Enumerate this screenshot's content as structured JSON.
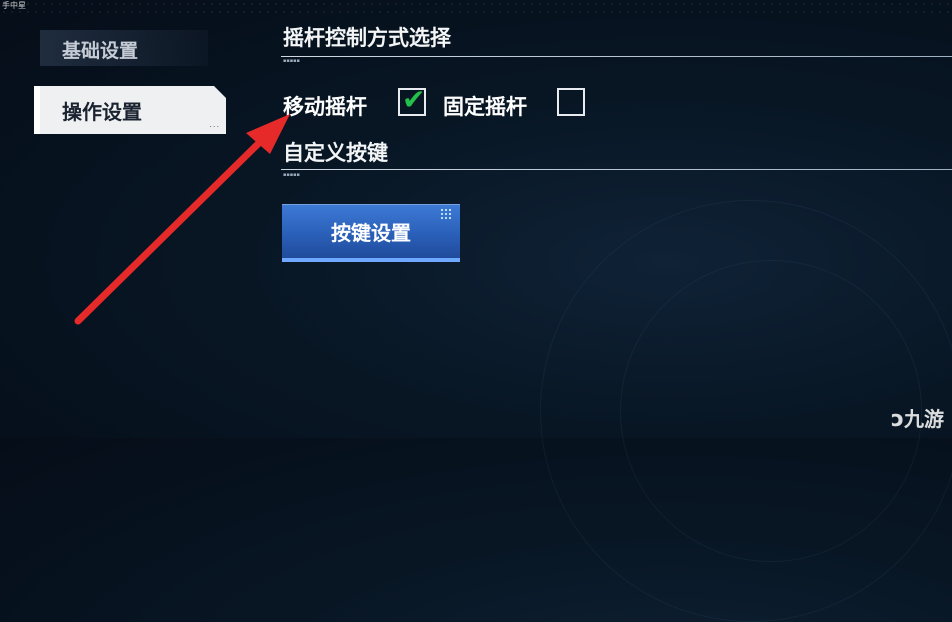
{
  "window": {
    "tiny_label": "手中星"
  },
  "sidebar": {
    "items": [
      {
        "label": "基础设置",
        "active": false
      },
      {
        "label": "操作设置",
        "active": true,
        "extra": "..."
      }
    ]
  },
  "main": {
    "joystick_section": {
      "title": "摇杆控制方式选择",
      "options": [
        {
          "label": "移动摇杆",
          "checked": true
        },
        {
          "label": "固定摇杆",
          "checked": false
        }
      ]
    },
    "custom_keys_section": {
      "title": "自定义按键",
      "button_label": "按键设置"
    }
  },
  "watermark": {
    "text": "九游"
  },
  "colors": {
    "accent_blue": "#2a5fb8",
    "check_green": "#23c04a",
    "arrow_red": "#e62a2a"
  },
  "icons": {
    "check": "checkmark-icon",
    "arrow": "annotation-arrow",
    "logo": "jiuyou-logo-icon"
  }
}
